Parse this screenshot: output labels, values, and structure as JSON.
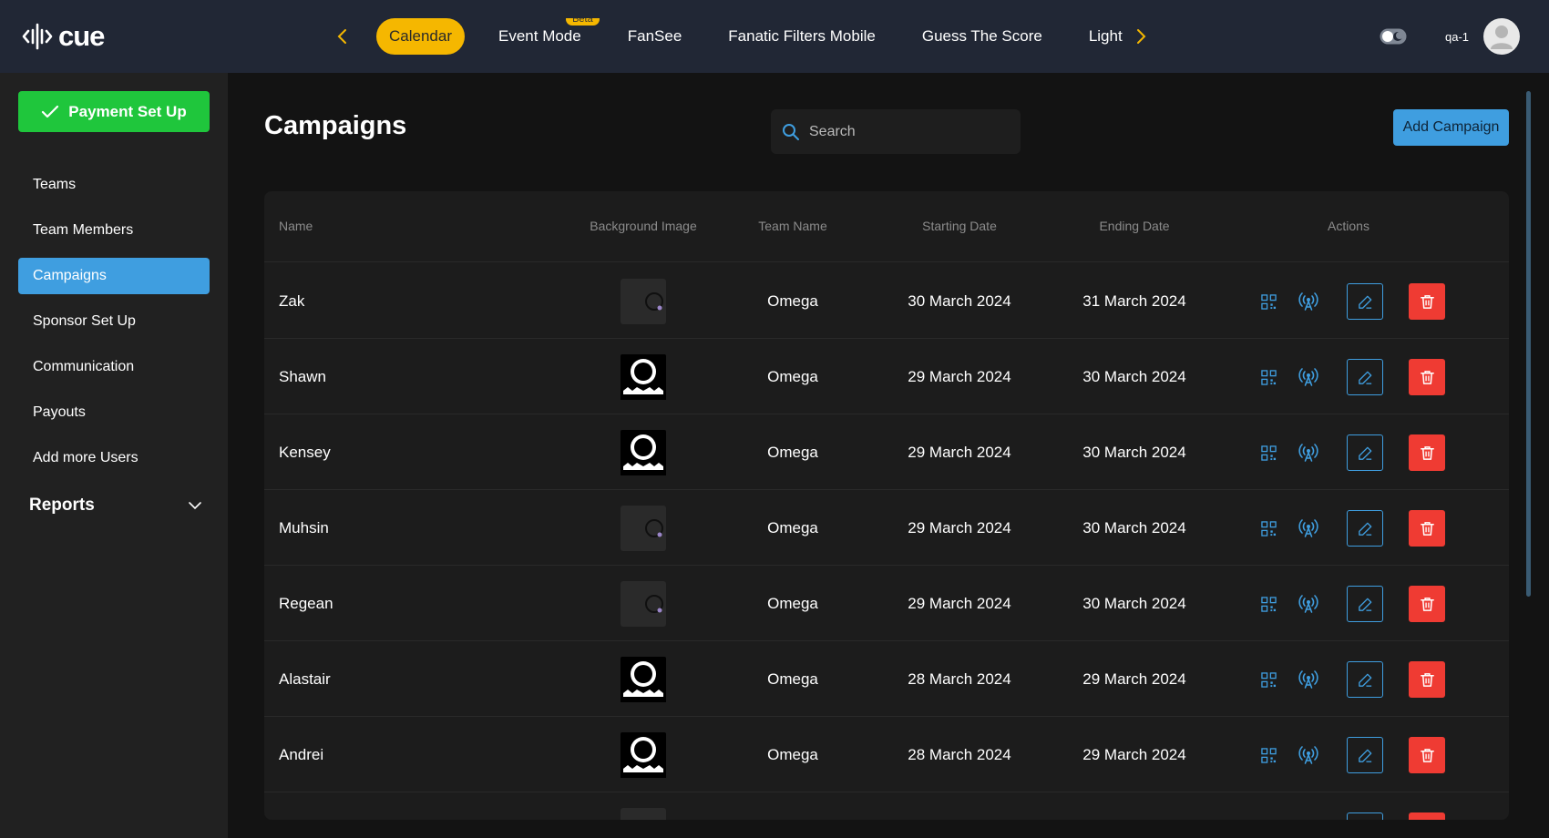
{
  "app": {
    "logo_text": "cue"
  },
  "nav": {
    "tabs": [
      {
        "label": "Calendar",
        "active": true,
        "badge": ""
      },
      {
        "label": "Event Mode",
        "active": false,
        "badge": "Beta"
      },
      {
        "label": "FanSee",
        "active": false,
        "badge": ""
      },
      {
        "label": "Fanatic Filters Mobile",
        "active": false,
        "badge": ""
      },
      {
        "label": "Guess The Score",
        "active": false,
        "badge": ""
      },
      {
        "label": "Light",
        "active": false,
        "badge": ""
      }
    ],
    "prev_icon": "chevron-left-icon",
    "next_icon": "chevron-right-icon"
  },
  "user": {
    "name": "qa-1",
    "avatar_icon": "user-avatar-icon",
    "theme_toggle_icon": "theme-toggle-icon"
  },
  "sidebar": {
    "payment_button": "Payment Set Up",
    "items": [
      {
        "label": "Teams",
        "active": false
      },
      {
        "label": "Team Members",
        "active": false
      },
      {
        "label": "Campaigns",
        "active": true
      },
      {
        "label": "Sponsor Set Up",
        "active": false
      },
      {
        "label": "Communication",
        "active": false
      },
      {
        "label": "Payouts",
        "active": false
      },
      {
        "label": "Add more Users",
        "active": false
      }
    ],
    "reports_label": "Reports"
  },
  "main": {
    "title": "Campaigns",
    "search_placeholder": "Search",
    "add_button": "Add Campaign"
  },
  "table": {
    "headers": [
      "Name",
      "Background Image",
      "Team Name",
      "Starting Date",
      "Ending Date",
      "Actions"
    ],
    "rows": [
      {
        "name": "Zak",
        "image": "loading",
        "team": "Omega",
        "start": "30 March 2024",
        "end": "31 March 2024"
      },
      {
        "name": "Shawn",
        "image": "gear",
        "team": "Omega",
        "start": "29 March 2024",
        "end": "30 March 2024"
      },
      {
        "name": "Kensey",
        "image": "gear",
        "team": "Omega",
        "start": "29 March 2024",
        "end": "30 March 2024"
      },
      {
        "name": "Muhsin",
        "image": "loading",
        "team": "Omega",
        "start": "29 March 2024",
        "end": "30 March 2024"
      },
      {
        "name": "Regean",
        "image": "loading",
        "team": "Omega",
        "start": "29 March 2024",
        "end": "30 March 2024"
      },
      {
        "name": "Alastair",
        "image": "gear",
        "team": "Omega",
        "start": "28 March 2024",
        "end": "29 March 2024"
      },
      {
        "name": "Andrei",
        "image": "gear",
        "team": "Omega",
        "start": "28 March 2024",
        "end": "29 March 2024"
      },
      {
        "name": "",
        "image": "loading",
        "team": "",
        "start": "",
        "end": ""
      }
    ],
    "action_icons": [
      "qr-code-icon",
      "broadcast-icon",
      "edit-icon",
      "delete-icon"
    ]
  },
  "colors": {
    "accent": "#3f9ee0",
    "active_tab": "#f5b700",
    "success": "#1fc63c",
    "danger": "#ef3b33",
    "topbar": "#212735"
  }
}
